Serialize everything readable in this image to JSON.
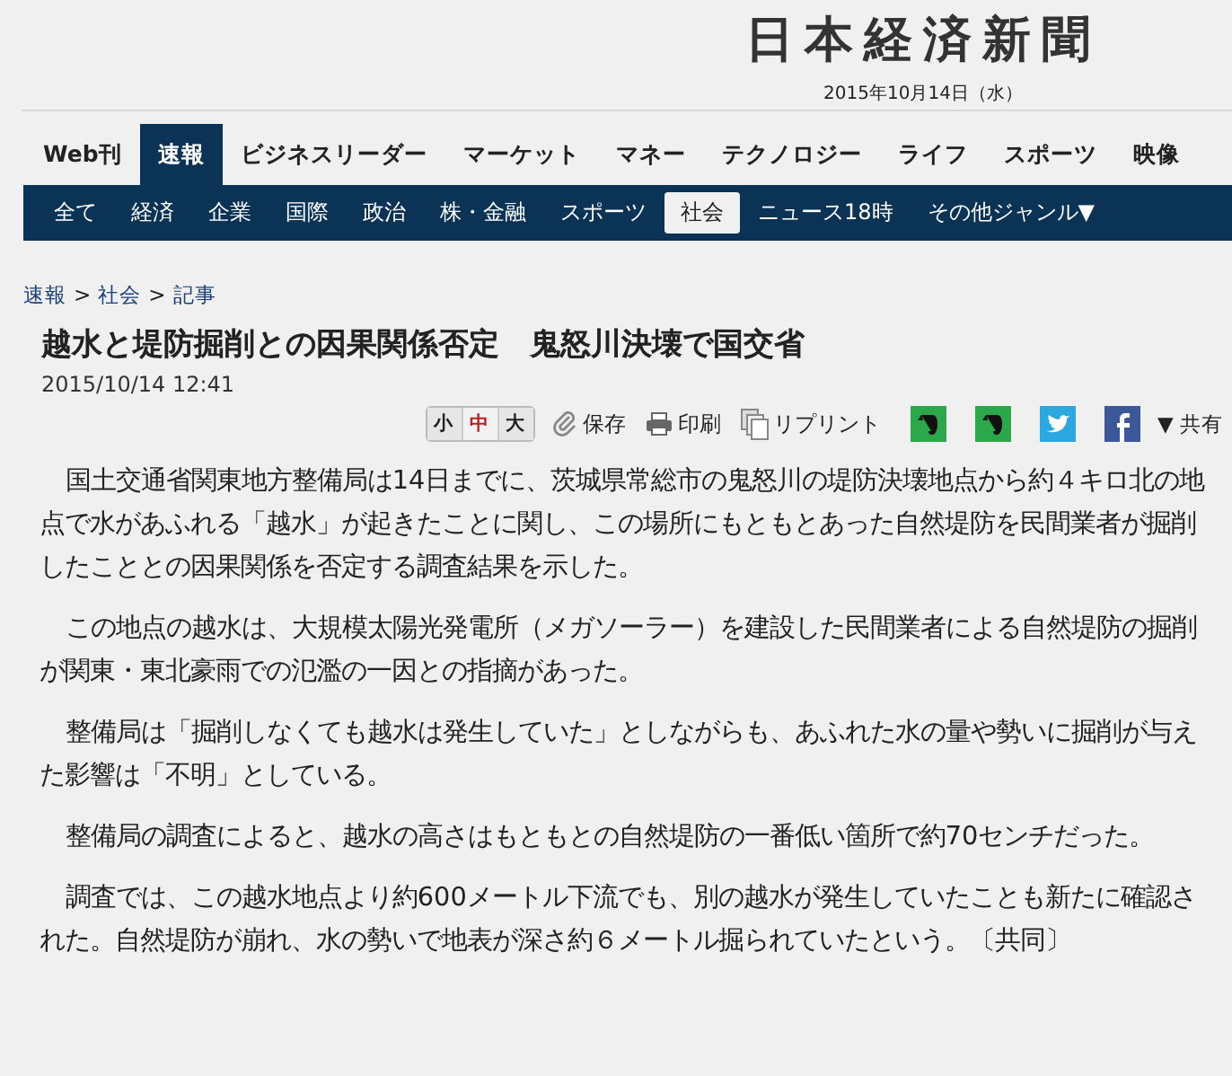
{
  "masthead": {
    "logo": "日本経済新聞",
    "date": "2015年10月14日（水）"
  },
  "main_nav": [
    {
      "label": "Web刊",
      "selected": false
    },
    {
      "label": "速報",
      "selected": true
    },
    {
      "label": "ビジネスリーダー",
      "selected": false
    },
    {
      "label": "マーケット",
      "selected": false
    },
    {
      "label": "マネー",
      "selected": false
    },
    {
      "label": "テクノロジー",
      "selected": false
    },
    {
      "label": "ライフ",
      "selected": false
    },
    {
      "label": "スポーツ",
      "selected": false
    },
    {
      "label": "映像",
      "selected": false
    }
  ],
  "sub_nav": [
    {
      "label": "全て",
      "selected": false
    },
    {
      "label": "経済",
      "selected": false
    },
    {
      "label": "企業",
      "selected": false
    },
    {
      "label": "国際",
      "selected": false
    },
    {
      "label": "政治",
      "selected": false
    },
    {
      "label": "株・金融",
      "selected": false
    },
    {
      "label": "スポーツ",
      "selected": false
    },
    {
      "label": "社会",
      "selected": true
    },
    {
      "label": "ニュース18時",
      "selected": false
    },
    {
      "label": "その他ジャンル▼",
      "selected": false
    }
  ],
  "breadcrumb": [
    {
      "label": "速報",
      "separator": ">"
    },
    {
      "label": "社会",
      "separator": ">"
    },
    {
      "label": "記事"
    }
  ],
  "article": {
    "title": "越水と堤防掘削との因果関係否定　鬼怒川決壊で国交省",
    "timestamp": "2015/10/14 12:41",
    "font_sizes": [
      {
        "label": "小",
        "selected": false
      },
      {
        "label": "中",
        "selected": true
      },
      {
        "label": "大",
        "selected": false
      }
    ],
    "tools": [
      {
        "kind": "save",
        "label": "保存"
      },
      {
        "kind": "print",
        "label": "印刷"
      },
      {
        "kind": "reprint",
        "label": "リプリント"
      }
    ],
    "share": [
      {
        "kind": "evernote"
      },
      {
        "kind": "evernote"
      },
      {
        "kind": "twitter"
      },
      {
        "kind": "facebook"
      }
    ],
    "share_menu": "▼ 共有",
    "paragraphs": [
      "国土交通省関東地方整備局は14日までに、茨城県常総市の鬼怒川の堤防決壊地点から約４キロ北の地点で水があふれる「越水」が起きたことに関し、この場所にもともとあった自然堤防を民間業者が掘削したこととの因果関係を否定する調査結果を示した。",
      "この地点の越水は、大規模太陽光発電所（メガソーラー）を建設した民間業者による自然堤防の掘削が関東・東北豪雨での氾濫の一因との指摘があった。",
      "整備局は「掘削しなくても越水は発生していた」としながらも、あふれた水の量や勢いに掘削が与えた影響は「不明」としている。",
      "整備局の調査によると、越水の高さはもともとの自然堤防の一番低い箇所で約70センチだった。",
      "調査では、この越水地点より約600メートル下流でも、別の越水が発生していたことも新たに確認された。自然堤防が崩れ、水の勢いで地表が深さ約６メートル掘られていたという。〔共同〕"
    ]
  }
}
